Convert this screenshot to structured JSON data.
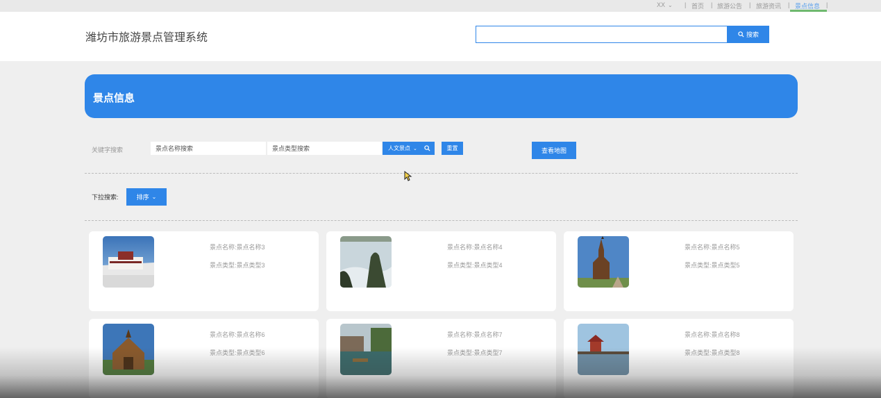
{
  "topbar": {
    "user": "XX",
    "nav": [
      {
        "label": "首页",
        "active": false
      },
      {
        "label": "旅游公告",
        "active": false
      },
      {
        "label": "旅游资讯",
        "active": false
      },
      {
        "label": "景点信息",
        "active": true
      }
    ],
    "separator": "|",
    "active_color": "#6fb96f"
  },
  "header": {
    "site_title": "潍坊市旅游景点管理系统",
    "search_value": "",
    "search_button": "搜索",
    "search_icon": "search-icon"
  },
  "banner": {
    "title": "景点信息"
  },
  "filters": {
    "keyword_label": "关键字搜索",
    "name_placeholder": "景点名称搜索",
    "type_placeholder": "景点类型搜索",
    "type_select": "人文景点",
    "reset_button": "重置",
    "map_button": "查看地图",
    "dropdown_label": "下拉搜索:",
    "sort_button": "排序"
  },
  "cards": [
    {
      "name": "景点名称:景点名称3",
      "type": "景点类型:景点类型3"
    },
    {
      "name": "景点名称:景点名称4",
      "type": "景点类型:景点类型4"
    },
    {
      "name": "景点名称:景点名称5",
      "type": "景点类型:景点类型5"
    },
    {
      "name": "景点名称:景点名称6",
      "type": "景点类型:景点类型6"
    },
    {
      "name": "景点名称:景点名称7",
      "type": "景点类型:景点类型7"
    },
    {
      "name": "景点名称:景点名称8",
      "type": "景点类型:景点类型8"
    }
  ],
  "colors": {
    "accent": "#2f86e8",
    "background": "#efefef"
  }
}
